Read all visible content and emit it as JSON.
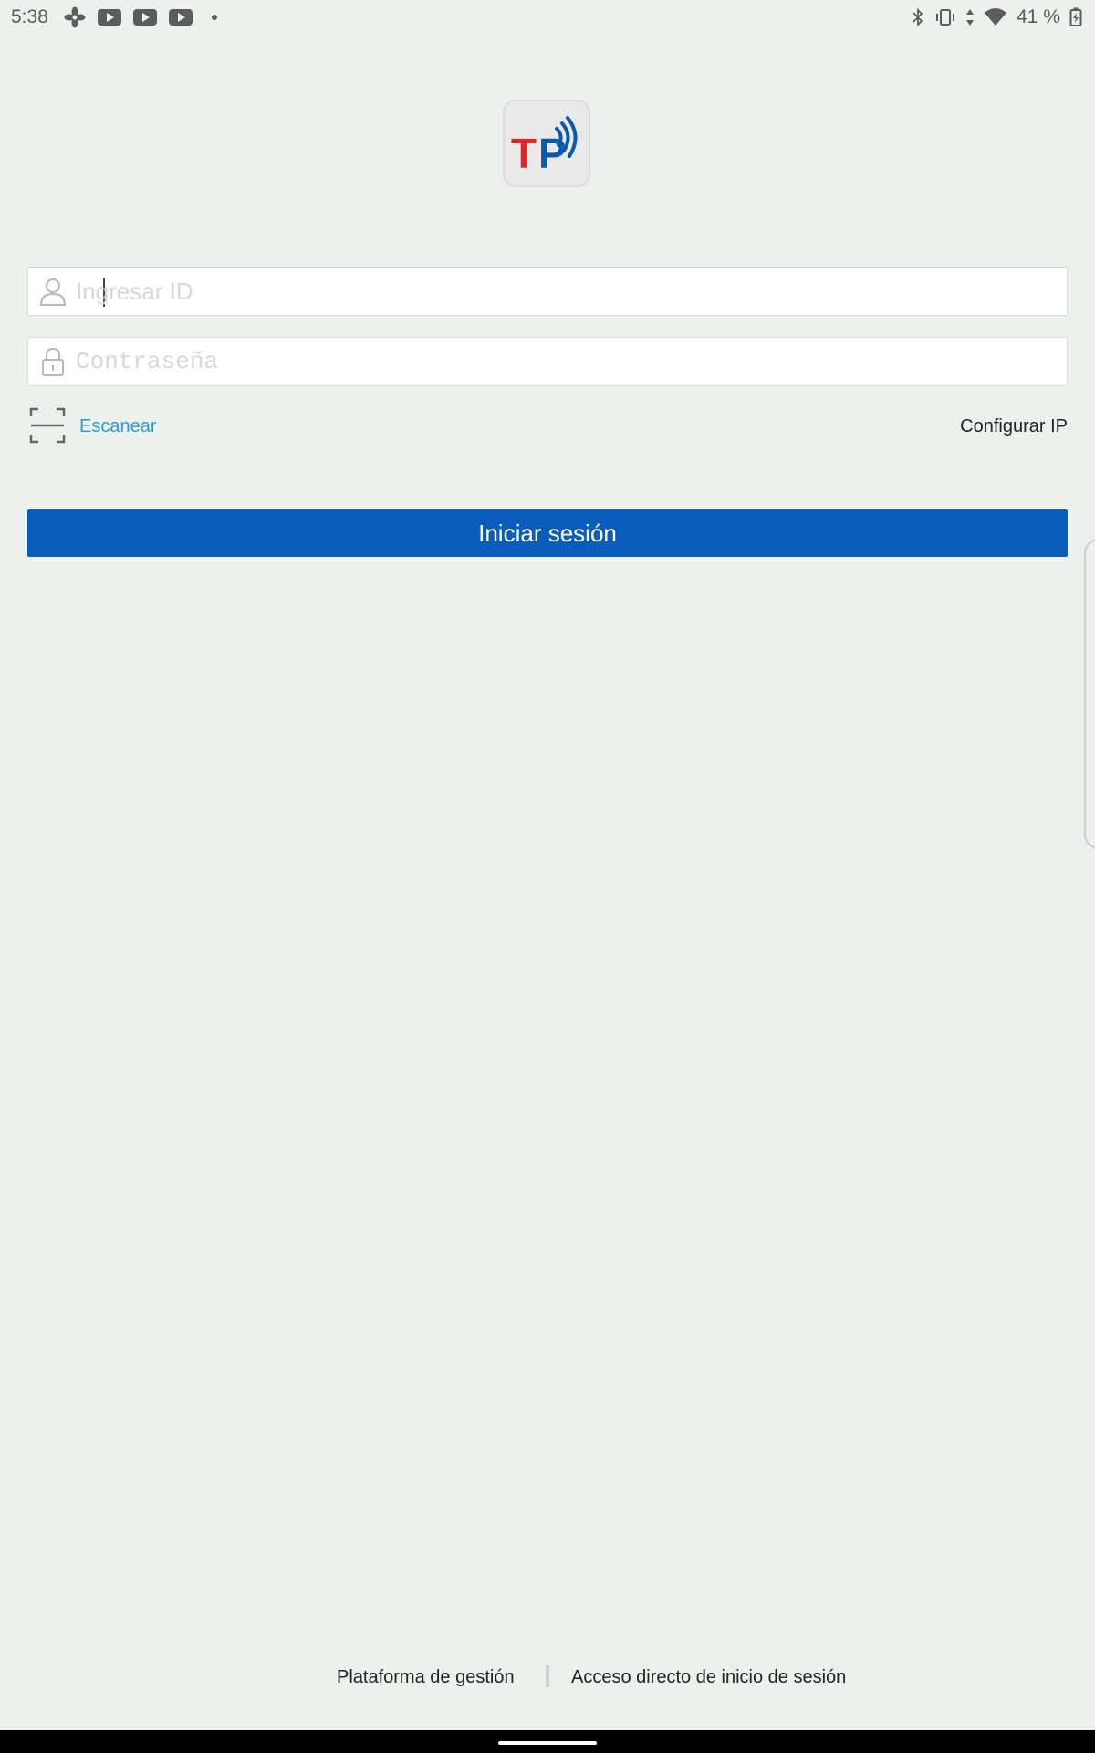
{
  "status_bar": {
    "time": "5:38",
    "battery_percent": "41 %",
    "left_icons": [
      "fan-icon",
      "youtube-icon",
      "youtube-icon",
      "youtube-icon",
      "dot-icon"
    ],
    "right_icons": [
      "bluetooth-icon",
      "vibrate-icon",
      "data-arrows-icon",
      "wifi-icon",
      "battery-icon"
    ]
  },
  "app": {
    "logo_letters": "TP"
  },
  "login_form": {
    "id_placeholder": "Ingresar ID",
    "password_placeholder": "Contraseña",
    "scan_label": "Escanear",
    "config_ip_label": "Configurar IP",
    "submit_label": "Iniciar sesión"
  },
  "footer": {
    "platform_link": "Plataforma de gestión",
    "shortcut_link": "Acceso directo de inicio de sesión"
  },
  "colors": {
    "background": "#edf1ee",
    "primary_button": "#0a5dbd",
    "scan_link": "#2a9ad6",
    "logo_red": "#e0252b",
    "logo_blue": "#0a5ba8"
  }
}
